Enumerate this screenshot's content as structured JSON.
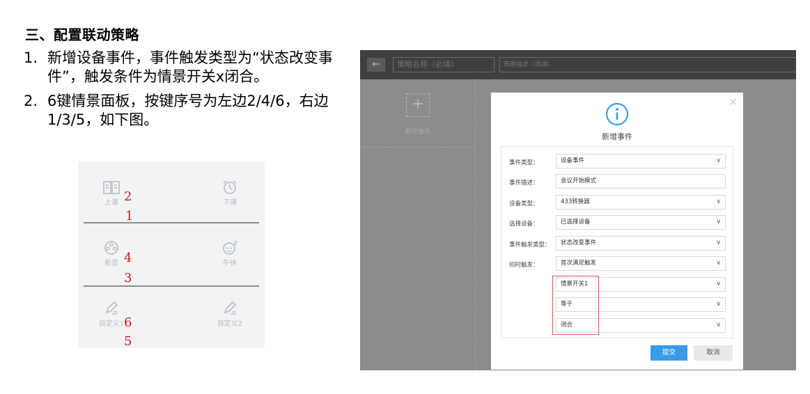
{
  "doc": {
    "heading": "三、配置联动策略",
    "items": [
      {
        "num": "1.",
        "text": "新增设备事件，事件触发类型为“状态改变事件”，触发条件为情景开关x闭合。"
      },
      {
        "num": "2.",
        "text": "6键情景面板，按键序号为左边2/4/6，右边1/3/5，如下图。"
      }
    ]
  },
  "panel": {
    "buttons": [
      {
        "label": "上课",
        "icon": "book-icon"
      },
      {
        "label": "下课",
        "icon": "alarm-clock-icon"
      },
      {
        "label": "影音",
        "icon": "film-reel-icon"
      },
      {
        "label": "午休",
        "icon": "sleep-face-icon"
      },
      {
        "label": "自定义1",
        "icon": "pencil-icon"
      },
      {
        "label": "自定义2",
        "icon": "pencil-icon"
      }
    ],
    "key_numbers": [
      "2",
      "1",
      "4",
      "3",
      "6",
      "5"
    ],
    "number_color": "#d01818"
  },
  "app": {
    "back_icon": "←",
    "name_placeholder": "策略名称（必填）",
    "desc_placeholder": "策略描述（选填）",
    "add_icon": "+",
    "add_label": "新增事件",
    "dialog": {
      "close_icon": "×",
      "title": "新增事件",
      "rows": [
        {
          "label": "事件类型：",
          "value": "设备事件",
          "select": true
        },
        {
          "label": "事件描述：",
          "value": "会议开始模式",
          "select": false
        },
        {
          "label": "设备类型：",
          "value": "433转换器",
          "select": true
        },
        {
          "label": "选择设备：",
          "value": "已选择设备",
          "select": true
        },
        {
          "label": "事件触发类型：",
          "value": "状态改变事件",
          "select": true
        },
        {
          "label": "何时触发：",
          "value": "首次满足触发",
          "select": true
        },
        {
          "label": "",
          "value": "情景开关1",
          "select": true
        },
        {
          "label": "",
          "value": "等于",
          "select": true
        },
        {
          "label": "",
          "value": "闭合",
          "select": true
        }
      ],
      "submit_label": "提交",
      "cancel_label": "取消",
      "accent_color": "#3a9be6",
      "highlight_color": "#e05555"
    }
  }
}
